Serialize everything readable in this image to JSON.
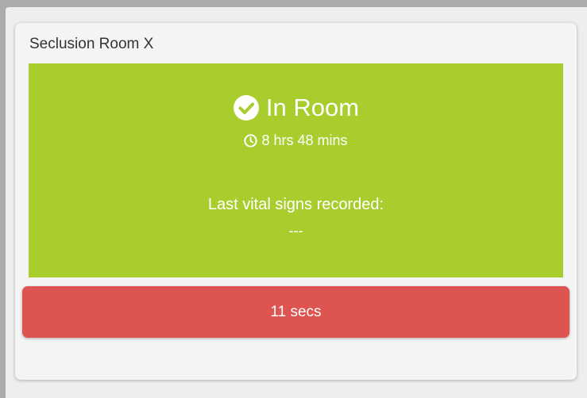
{
  "card": {
    "title": "Seclusion Room X"
  },
  "status": {
    "label": "In Room",
    "duration": "8 hrs 48 mins",
    "vitals_label": "Last vital signs recorded:",
    "vitals_value": "---",
    "icon": "check-circle-icon",
    "duration_icon": "clock-icon"
  },
  "timer": {
    "label": "11 secs"
  },
  "colors": {
    "status_green": "#a8cd2c",
    "timer_red": "#dd5450"
  }
}
